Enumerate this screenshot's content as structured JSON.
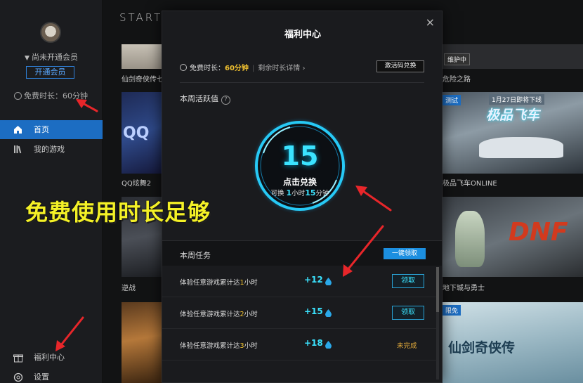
{
  "sidebar": {
    "vip_status": "尚未开通会员",
    "vip_button": "开通会员",
    "free_time": "免费时长：60分钟",
    "nav": [
      {
        "label": "首页",
        "active": true
      },
      {
        "label": "我的游戏",
        "active": false
      }
    ],
    "bottom": [
      {
        "label": "福利中心"
      },
      {
        "label": "设置"
      }
    ]
  },
  "content": {
    "logo": "START",
    "tiles": [
      {
        "label": "仙剑奇侠传七"
      },
      {
        "label": "QQ炫舞2"
      },
      {
        "label": "逆战"
      },
      {
        "label": "危险之路",
        "badge": "维护中"
      },
      {
        "label": "极品飞车ONLINE",
        "badge": "测试",
        "banner": "1月27日即将下线",
        "art_text": "极品飞车"
      },
      {
        "label": "地下城与勇士",
        "art_text": "DNF"
      },
      {
        "badge": "限免",
        "art_text": "仙剑奇侠传"
      }
    ]
  },
  "modal": {
    "title": "福利中心",
    "close": "×",
    "free_label": "免费时长：",
    "free_value": "60分钟",
    "remaining_link": "剩余时长详情",
    "activate_button": "激活码兑换",
    "weekly_activity": "本周活跃值",
    "help": "?",
    "ring": {
      "value": "15",
      "action": "点击兑换",
      "sub_prefix": "可换 ",
      "sub_hours": "1",
      "sub_mid": "小时",
      "sub_minutes": "15",
      "sub_suffix": "分钟"
    },
    "tasks_title": "本周任务",
    "claim_all": "一键领取",
    "tasks": [
      {
        "prefix": "体验任意游戏累计达",
        "hours": "1",
        "suffix": "小时",
        "points": "+12",
        "action": "领取",
        "status": "claimable"
      },
      {
        "prefix": "体验任意游戏累计达",
        "hours": "2",
        "suffix": "小时",
        "points": "+15",
        "action": "领取",
        "status": "claimable"
      },
      {
        "prefix": "体验任意游戏累计达",
        "hours": "3",
        "suffix": "小时",
        "points": "+18",
        "action": "未完成",
        "status": "incomplete"
      }
    ]
  },
  "overlay": {
    "caption": "免费使用时长足够"
  },
  "colors": {
    "accent_blue": "#1c6dc2",
    "ring_cyan": "#3be3ff",
    "highlight_yellow": "#f2c230",
    "caption_yellow": "#f4f127",
    "annotation_red": "#e8262a"
  }
}
